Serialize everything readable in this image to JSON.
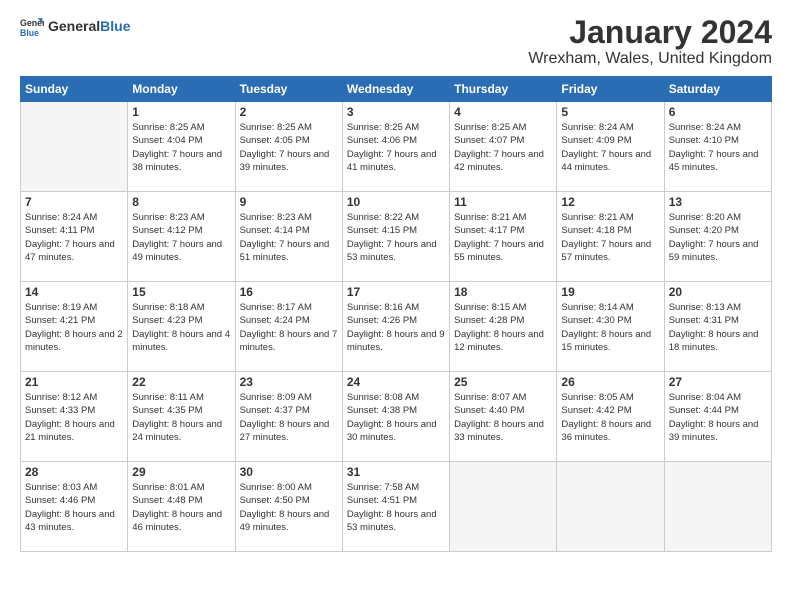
{
  "header": {
    "logo_general": "General",
    "logo_blue": "Blue",
    "month_title": "January 2024",
    "location": "Wrexham, Wales, United Kingdom"
  },
  "weekdays": [
    "Sunday",
    "Monday",
    "Tuesday",
    "Wednesday",
    "Thursday",
    "Friday",
    "Saturday"
  ],
  "weeks": [
    [
      {
        "day": "",
        "sunrise": "",
        "sunset": "",
        "daylight": "",
        "empty": true
      },
      {
        "day": "1",
        "sunrise": "Sunrise: 8:25 AM",
        "sunset": "Sunset: 4:04 PM",
        "daylight": "Daylight: 7 hours and 38 minutes."
      },
      {
        "day": "2",
        "sunrise": "Sunrise: 8:25 AM",
        "sunset": "Sunset: 4:05 PM",
        "daylight": "Daylight: 7 hours and 39 minutes."
      },
      {
        "day": "3",
        "sunrise": "Sunrise: 8:25 AM",
        "sunset": "Sunset: 4:06 PM",
        "daylight": "Daylight: 7 hours and 41 minutes."
      },
      {
        "day": "4",
        "sunrise": "Sunrise: 8:25 AM",
        "sunset": "Sunset: 4:07 PM",
        "daylight": "Daylight: 7 hours and 42 minutes."
      },
      {
        "day": "5",
        "sunrise": "Sunrise: 8:24 AM",
        "sunset": "Sunset: 4:09 PM",
        "daylight": "Daylight: 7 hours and 44 minutes."
      },
      {
        "day": "6",
        "sunrise": "Sunrise: 8:24 AM",
        "sunset": "Sunset: 4:10 PM",
        "daylight": "Daylight: 7 hours and 45 minutes."
      }
    ],
    [
      {
        "day": "7",
        "sunrise": "Sunrise: 8:24 AM",
        "sunset": "Sunset: 4:11 PM",
        "daylight": "Daylight: 7 hours and 47 minutes."
      },
      {
        "day": "8",
        "sunrise": "Sunrise: 8:23 AM",
        "sunset": "Sunset: 4:12 PM",
        "daylight": "Daylight: 7 hours and 49 minutes."
      },
      {
        "day": "9",
        "sunrise": "Sunrise: 8:23 AM",
        "sunset": "Sunset: 4:14 PM",
        "daylight": "Daylight: 7 hours and 51 minutes."
      },
      {
        "day": "10",
        "sunrise": "Sunrise: 8:22 AM",
        "sunset": "Sunset: 4:15 PM",
        "daylight": "Daylight: 7 hours and 53 minutes."
      },
      {
        "day": "11",
        "sunrise": "Sunrise: 8:21 AM",
        "sunset": "Sunset: 4:17 PM",
        "daylight": "Daylight: 7 hours and 55 minutes."
      },
      {
        "day": "12",
        "sunrise": "Sunrise: 8:21 AM",
        "sunset": "Sunset: 4:18 PM",
        "daylight": "Daylight: 7 hours and 57 minutes."
      },
      {
        "day": "13",
        "sunrise": "Sunrise: 8:20 AM",
        "sunset": "Sunset: 4:20 PM",
        "daylight": "Daylight: 7 hours and 59 minutes."
      }
    ],
    [
      {
        "day": "14",
        "sunrise": "Sunrise: 8:19 AM",
        "sunset": "Sunset: 4:21 PM",
        "daylight": "Daylight: 8 hours and 2 minutes."
      },
      {
        "day": "15",
        "sunrise": "Sunrise: 8:18 AM",
        "sunset": "Sunset: 4:23 PM",
        "daylight": "Daylight: 8 hours and 4 minutes."
      },
      {
        "day": "16",
        "sunrise": "Sunrise: 8:17 AM",
        "sunset": "Sunset: 4:24 PM",
        "daylight": "Daylight: 8 hours and 7 minutes."
      },
      {
        "day": "17",
        "sunrise": "Sunrise: 8:16 AM",
        "sunset": "Sunset: 4:26 PM",
        "daylight": "Daylight: 8 hours and 9 minutes."
      },
      {
        "day": "18",
        "sunrise": "Sunrise: 8:15 AM",
        "sunset": "Sunset: 4:28 PM",
        "daylight": "Daylight: 8 hours and 12 minutes."
      },
      {
        "day": "19",
        "sunrise": "Sunrise: 8:14 AM",
        "sunset": "Sunset: 4:30 PM",
        "daylight": "Daylight: 8 hours and 15 minutes."
      },
      {
        "day": "20",
        "sunrise": "Sunrise: 8:13 AM",
        "sunset": "Sunset: 4:31 PM",
        "daylight": "Daylight: 8 hours and 18 minutes."
      }
    ],
    [
      {
        "day": "21",
        "sunrise": "Sunrise: 8:12 AM",
        "sunset": "Sunset: 4:33 PM",
        "daylight": "Daylight: 8 hours and 21 minutes."
      },
      {
        "day": "22",
        "sunrise": "Sunrise: 8:11 AM",
        "sunset": "Sunset: 4:35 PM",
        "daylight": "Daylight: 8 hours and 24 minutes."
      },
      {
        "day": "23",
        "sunrise": "Sunrise: 8:09 AM",
        "sunset": "Sunset: 4:37 PM",
        "daylight": "Daylight: 8 hours and 27 minutes."
      },
      {
        "day": "24",
        "sunrise": "Sunrise: 8:08 AM",
        "sunset": "Sunset: 4:38 PM",
        "daylight": "Daylight: 8 hours and 30 minutes."
      },
      {
        "day": "25",
        "sunrise": "Sunrise: 8:07 AM",
        "sunset": "Sunset: 4:40 PM",
        "daylight": "Daylight: 8 hours and 33 minutes."
      },
      {
        "day": "26",
        "sunrise": "Sunrise: 8:05 AM",
        "sunset": "Sunset: 4:42 PM",
        "daylight": "Daylight: 8 hours and 36 minutes."
      },
      {
        "day": "27",
        "sunrise": "Sunrise: 8:04 AM",
        "sunset": "Sunset: 4:44 PM",
        "daylight": "Daylight: 8 hours and 39 minutes."
      }
    ],
    [
      {
        "day": "28",
        "sunrise": "Sunrise: 8:03 AM",
        "sunset": "Sunset: 4:46 PM",
        "daylight": "Daylight: 8 hours and 43 minutes."
      },
      {
        "day": "29",
        "sunrise": "Sunrise: 8:01 AM",
        "sunset": "Sunset: 4:48 PM",
        "daylight": "Daylight: 8 hours and 46 minutes."
      },
      {
        "day": "30",
        "sunrise": "Sunrise: 8:00 AM",
        "sunset": "Sunset: 4:50 PM",
        "daylight": "Daylight: 8 hours and 49 minutes."
      },
      {
        "day": "31",
        "sunrise": "Sunrise: 7:58 AM",
        "sunset": "Sunset: 4:51 PM",
        "daylight": "Daylight: 8 hours and 53 minutes."
      },
      {
        "day": "",
        "sunrise": "",
        "sunset": "",
        "daylight": "",
        "empty": true
      },
      {
        "day": "",
        "sunrise": "",
        "sunset": "",
        "daylight": "",
        "empty": true
      },
      {
        "day": "",
        "sunrise": "",
        "sunset": "",
        "daylight": "",
        "empty": true
      }
    ]
  ]
}
